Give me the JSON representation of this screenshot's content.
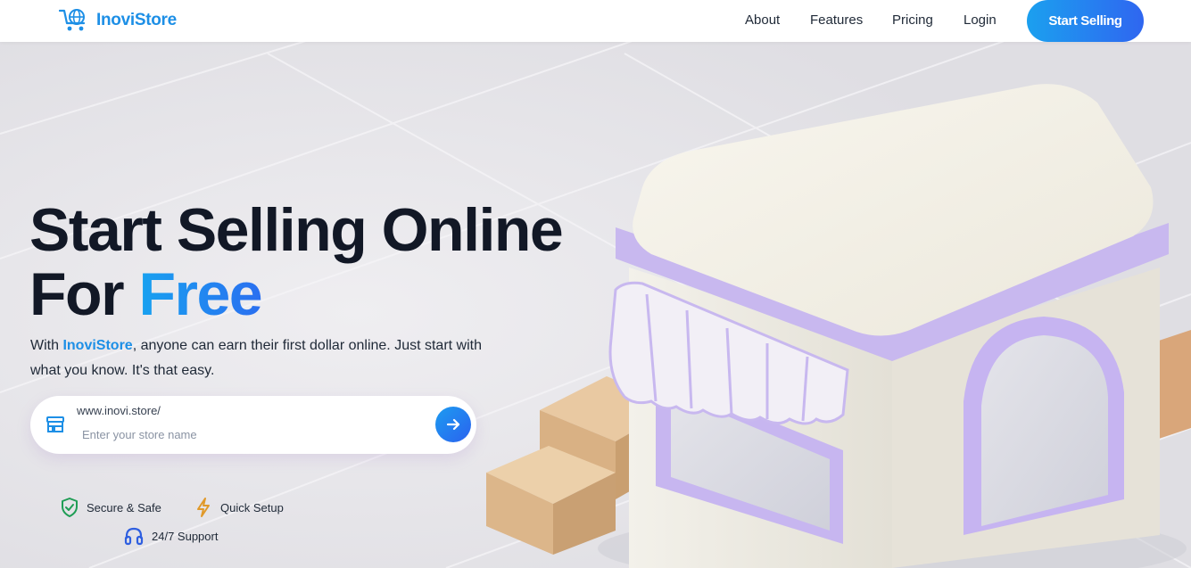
{
  "header": {
    "brand": "InoviStore",
    "nav": [
      "About",
      "Features",
      "Pricing",
      "Login"
    ],
    "cta_label": "Start Selling"
  },
  "hero": {
    "title_line1": "Start Selling Online",
    "title_line2_prefix": "For ",
    "title_line2_accent": "Free",
    "subtitle_prefix": "With ",
    "subtitle_brand": "InoviStore",
    "subtitle_suffix": ", anyone can earn their first dollar online. Just start with what you know. It's that easy."
  },
  "store_form": {
    "prefix": "www.inovi.store/",
    "placeholder": "Enter your store name",
    "value": ""
  },
  "features": [
    "Secure & Safe",
    "Quick Setup",
    "24/7 Support"
  ],
  "colors": {
    "brand_blue": "#1d8fe6",
    "cta_gradient_start": "#1ba0ef",
    "cta_gradient_end": "#2f66f0",
    "shield_green": "#1f9d55",
    "bolt_amber": "#e0992a",
    "support_blue": "#2f5fe0"
  },
  "icons": {
    "logo": "cart-globe-icon",
    "store": "storefront-icon",
    "submit": "arrow-right-icon",
    "secure": "shield-check-icon",
    "setup": "lightning-bolt-icon",
    "support": "headset-icon"
  }
}
